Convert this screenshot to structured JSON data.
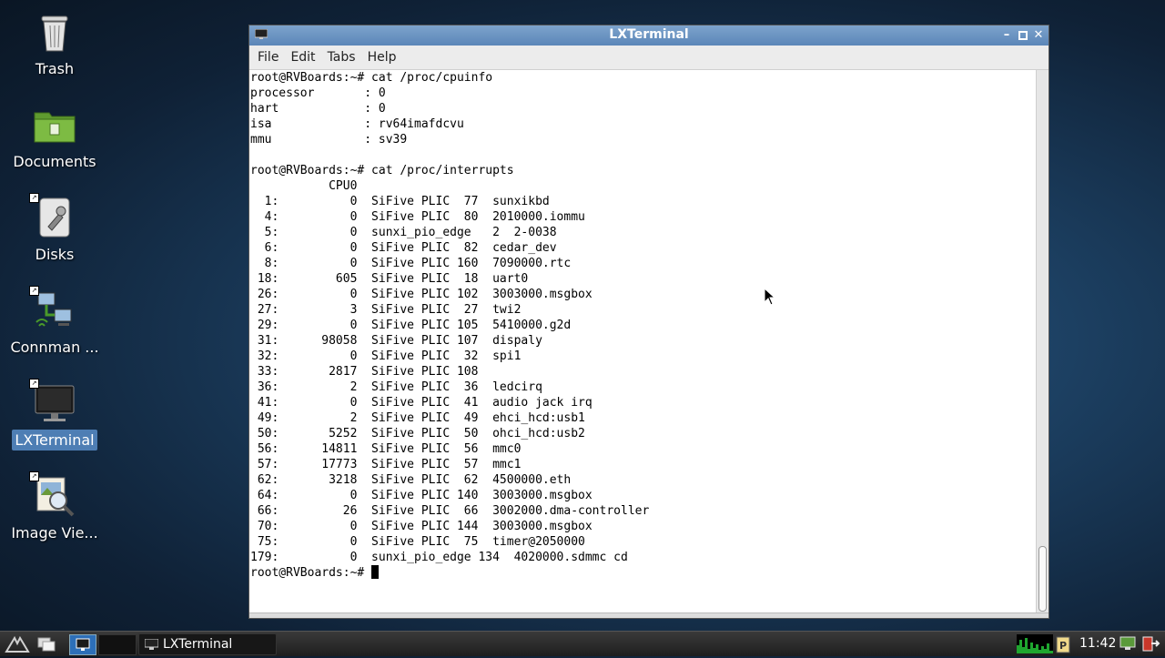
{
  "desktop": {
    "icons": [
      {
        "label": "Trash"
      },
      {
        "label": "Documents"
      },
      {
        "label": "Disks"
      },
      {
        "label": "Connman ..."
      },
      {
        "label": "LXTerminal"
      },
      {
        "label": "Image Vie..."
      }
    ]
  },
  "window": {
    "title": "LXTerminal",
    "menu": [
      "File",
      "Edit",
      "Tabs",
      "Help"
    ],
    "terminal": {
      "lines": [
        "root@RVBoards:~# cat /proc/cpuinfo",
        "processor       : 0",
        "hart            : 0",
        "isa             : rv64imafdcvu",
        "mmu             : sv39",
        "",
        "root@RVBoards:~# cat /proc/interrupts",
        "           CPU0",
        "  1:          0  SiFive PLIC  77  sunxikbd",
        "  4:          0  SiFive PLIC  80  2010000.iommu",
        "  5:          0  sunxi_pio_edge   2  2-0038",
        "  6:          0  SiFive PLIC  82  cedar_dev",
        "  8:          0  SiFive PLIC 160  7090000.rtc",
        " 18:        605  SiFive PLIC  18  uart0",
        " 26:          0  SiFive PLIC 102  3003000.msgbox",
        " 27:          3  SiFive PLIC  27  twi2",
        " 29:          0  SiFive PLIC 105  5410000.g2d",
        " 31:      98058  SiFive PLIC 107  dispaly",
        " 32:          0  SiFive PLIC  32  spi1",
        " 33:       2817  SiFive PLIC 108",
        " 36:          2  SiFive PLIC  36  ledcirq",
        " 41:          0  SiFive PLIC  41  audio jack irq",
        " 49:          2  SiFive PLIC  49  ehci_hcd:usb1",
        " 50:       5252  SiFive PLIC  50  ohci_hcd:usb2",
        " 56:      14811  SiFive PLIC  56  mmc0",
        " 57:      17773  SiFive PLIC  57  mmc1",
        " 62:       3218  SiFive PLIC  62  4500000.eth",
        " 64:          0  SiFive PLIC 140  3003000.msgbox",
        " 66:         26  SiFive PLIC  66  3002000.dma-controller",
        " 70:          0  SiFive PLIC 144  3003000.msgbox",
        " 75:          0  SiFive PLIC  75  timer@2050000",
        "179:          0  sunxi_pio_edge 134  4020000.sdmmc cd"
      ],
      "prompt": "root@RVBoards:~# "
    }
  },
  "taskbar": {
    "task_label": "LXTerminal",
    "clock": "11:42"
  }
}
